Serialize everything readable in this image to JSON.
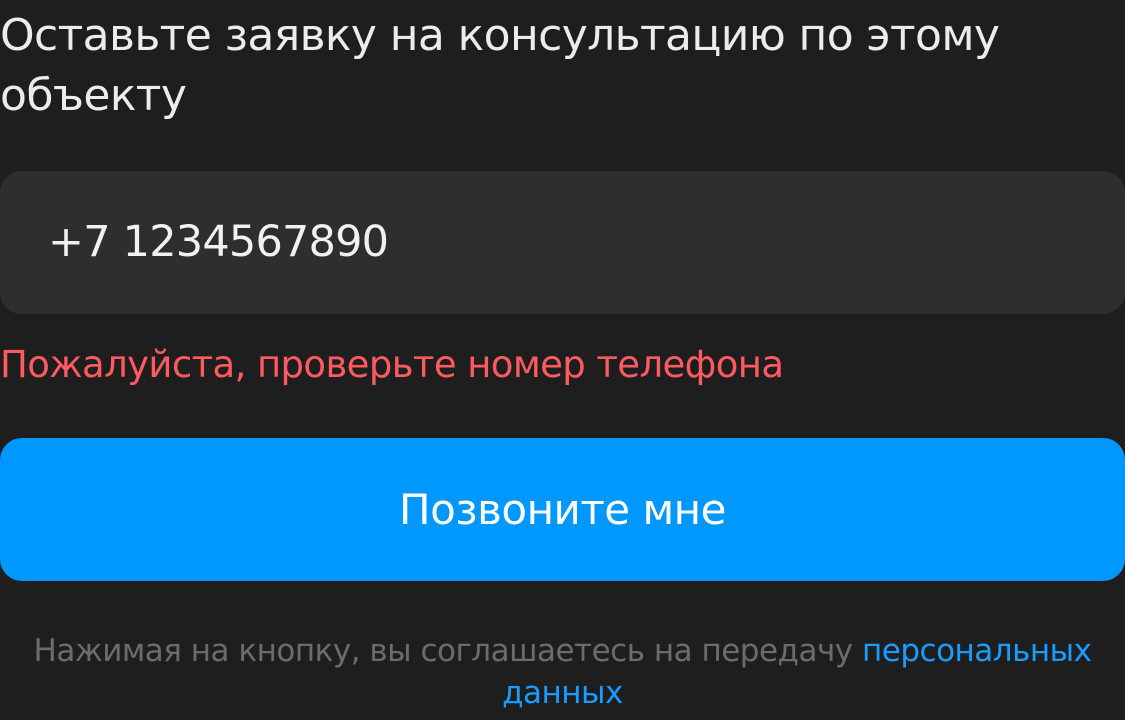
{
  "form": {
    "heading": "Оставьте заявку на консультацию по этому объекту",
    "phone_value": "+7 1234567890",
    "error_message": "Пожалуйста, проверьте номер телефона",
    "submit_label": "Позвоните мне",
    "consent_text": "Нажимая на кнопку, вы соглашаетесь на передачу ",
    "consent_link_part1": "персональных",
    "consent_link_part2": "данных"
  },
  "colors": {
    "background": "#1e1e1e",
    "field_background": "#2e2e2e",
    "error": "#ff5a60",
    "accent": "#0098ff",
    "link": "#1a9bff",
    "muted_text": "#6c6c6c"
  }
}
